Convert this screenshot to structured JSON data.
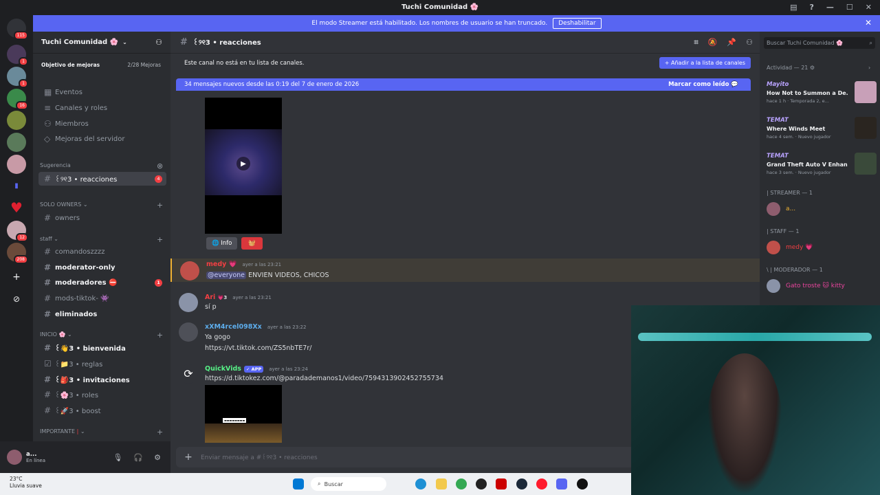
{
  "window": {
    "title": "Tuchi Comunidad 🌸"
  },
  "streamer_banner": {
    "text": "El modo Streamer está habilitado. Los nombres de usuario se han truncado.",
    "button": "Deshabilitar"
  },
  "server_badges": [
    "115",
    "1",
    "1",
    "16",
    "12",
    "208"
  ],
  "guild": {
    "name": "Tuchi Comunidad 🌸",
    "boost_label": "Objetivo de mejoras",
    "boost_value": "2/28 Mejoras"
  },
  "nav": [
    "Eventos",
    "Canales y roles",
    "Miembros",
    "Mejoras del servidor"
  ],
  "categories": {
    "sugerencia": "Sugerencia",
    "solo_owners": "SOLO OWNERS",
    "staff": "staff",
    "inicio": "INICIO 🌸",
    "importante": "IMPORTANTE"
  },
  "channels": {
    "reacciones": "꒰୨୧3 • reacciones",
    "reacciones_badge": "4",
    "owners": "owners",
    "comandoszzzz": "comandoszzzz",
    "moderator_only": "moderator-only",
    "moderadores": "moderadores ⛔",
    "moderadores_badge": "1",
    "mods_tiktok": "mods-tiktok- 👾",
    "eliminados": "eliminados",
    "bienvenida": "꒰👋3 • bienvenida",
    "reglas": "꒰📁3 • reglas",
    "invitaciones": "꒰🎒3 • invitaciones",
    "roles": "꒰🌸3 • roles",
    "boost": "꒰🚀3 • boost"
  },
  "user": {
    "name": "a...",
    "status": "En línea"
  },
  "header": {
    "channel": "꒰୨୧3 • reacciones"
  },
  "notice": {
    "text": "Este canal no está en tu lista de canales.",
    "button": "Añadir a la lista de canales"
  },
  "new_messages": {
    "text": "34 mensajes nuevos desde las 0:19 del 7 de enero de 2026",
    "mark": "Marcar como leído"
  },
  "buttons": {
    "info": "Info",
    "red": "🧺"
  },
  "messages": [
    {
      "author": "medy",
      "time": "ayer a las 23:21",
      "mention": "@everyone",
      "text": "ENVIEN VIDEOS, CHICOS"
    },
    {
      "author": "Ari",
      "tag": "💗3",
      "time": "ayer a las 23:21",
      "text": "sí p"
    },
    {
      "author": "xXM4rcel098Xx",
      "time": "ayer a las 23:22",
      "text": "Ya gogo",
      "link": "https://vt.tiktok.com/ZS5nbTE7r/"
    },
    {
      "author": "QuickVids",
      "badge": "✓ APP",
      "time": "ayer a las 23:24",
      "link": "https://d.tiktokez.com/@paradademanos1/video/7594313902452755734"
    }
  ],
  "composer": {
    "placeholder": "Enviar mensaje a #꒰୨୧3 • reacciones"
  },
  "search": {
    "placeholder": "Buscar Tuchi Comunidad 🌸"
  },
  "activity": {
    "header": "Actividad — 21 ⚙",
    "items": [
      {
        "user": "Mayito",
        "title": "How Not to Summon a De...",
        "meta": "hace 1 h · Temporada 2, e..."
      },
      {
        "user": "TEMAT",
        "title": "Where Winds Meet",
        "meta": "hace 4 sem. · Nuevo jugador"
      },
      {
        "user": "TEMAT",
        "title": "Grand Theft Auto V Enhan...",
        "meta": "hace 3 sem. · Nuevo jugador"
      }
    ]
  },
  "roles": [
    {
      "label": "| STREAMER — 1",
      "member": "a..."
    },
    {
      "label": "| STAFF — 1",
      "member": "medy 💗"
    },
    {
      "label": "\\ | MODERADOR — 1",
      "member": "Gato troste 🐱 kitty"
    }
  ],
  "taskbar": {
    "temp": "23°C",
    "weather": "Lluvia suave",
    "search": "Buscar"
  }
}
